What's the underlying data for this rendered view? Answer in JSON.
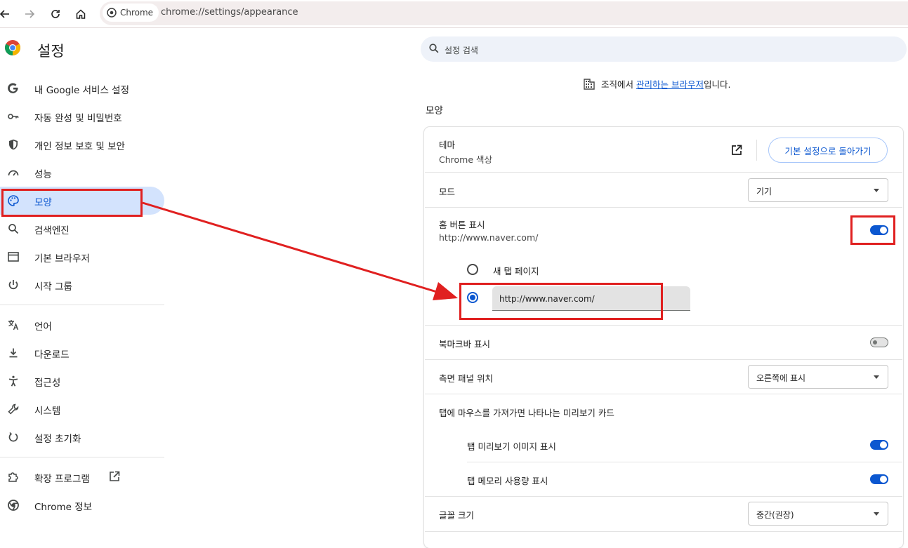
{
  "browser": {
    "chip_label": "Chrome",
    "url": "chrome://settings/appearance"
  },
  "sidebar": {
    "title": "설정",
    "items": [
      {
        "label": "내 Google 서비스 설정",
        "icon": "google-g-icon"
      },
      {
        "label": "자동 완성 및 비밀번호",
        "icon": "key-icon"
      },
      {
        "label": "개인 정보 보호 및 보안",
        "icon": "shield-icon"
      },
      {
        "label": "성능",
        "icon": "speedometer-icon"
      },
      {
        "label": "모양",
        "icon": "palette-icon"
      },
      {
        "label": "검색엔진",
        "icon": "search-icon"
      },
      {
        "label": "기본 브라우저",
        "icon": "browser-window-icon"
      },
      {
        "label": "시작 그룹",
        "icon": "power-icon"
      },
      {
        "label": "언어",
        "icon": "translate-icon"
      },
      {
        "label": "다운로드",
        "icon": "download-icon"
      },
      {
        "label": "접근성",
        "icon": "accessibility-icon"
      },
      {
        "label": "시스템",
        "icon": "wrench-icon"
      },
      {
        "label": "설정 초기화",
        "icon": "reset-icon"
      },
      {
        "label": "확장 프로그램",
        "icon": "puzzle-icon"
      },
      {
        "label": "Chrome 정보",
        "icon": "chrome-icon"
      }
    ]
  },
  "search": {
    "placeholder": "설정 검색"
  },
  "managed": {
    "prefix": "조직에서 ",
    "link": "관리하는 브라우저",
    "suffix": "입니다."
  },
  "section": {
    "title": "모양"
  },
  "theme": {
    "label": "테마",
    "value": "Chrome 색상",
    "reset_button": "기본 설정으로 돌아가기"
  },
  "mode": {
    "label": "모드",
    "value": "기기"
  },
  "home_button": {
    "label": "홈 버튼 표시",
    "url": "http://www.naver.com/",
    "enabled": true,
    "option_new_tab": "새 탭 페이지",
    "custom_url_value": "http://www.naver.com/"
  },
  "bookmarks_bar": {
    "label": "북마크바 표시",
    "enabled": false
  },
  "side_panel": {
    "label": "측면 패널 위치",
    "value": "오른쪽에 표시"
  },
  "hover_card": {
    "label": "탭에 마우스를 가져가면 나타나는 미리보기 카드",
    "preview_image": {
      "label": "탭 미리보기 이미지 표시",
      "enabled": true
    },
    "memory_usage": {
      "label": "탭 메모리 사용량 표시",
      "enabled": true
    }
  },
  "font_size": {
    "label": "글꼴 크기",
    "value": "중간(권장)"
  },
  "colors": {
    "accent": "#0b57d0",
    "annotation": "#e02020",
    "active_nav": "#d3e3fd"
  }
}
